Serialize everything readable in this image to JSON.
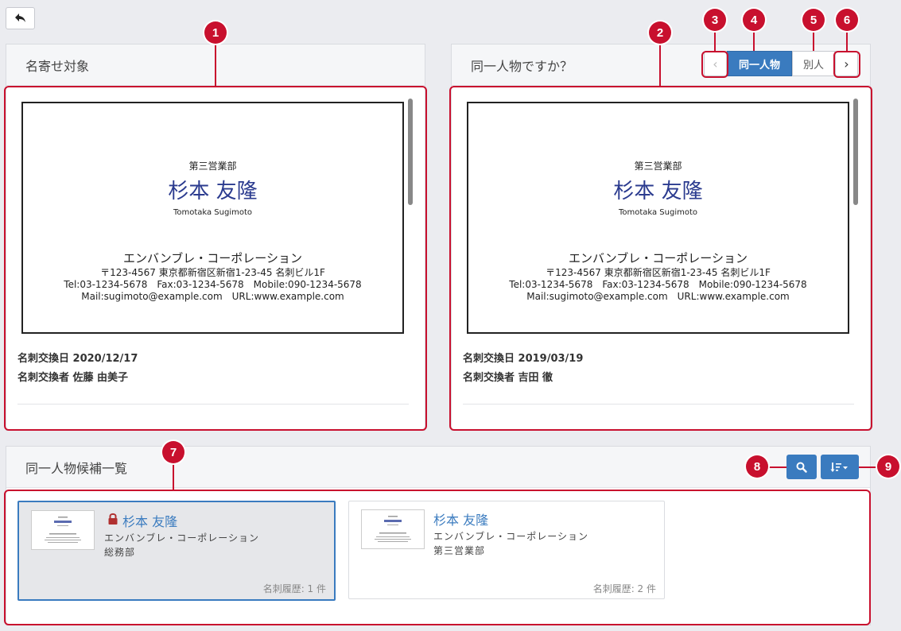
{
  "back_button": {
    "icon": "reply-arrow-icon"
  },
  "left_panel": {
    "title": "名寄せ対象",
    "card": {
      "department": "第三営業部",
      "name": "杉本 友隆",
      "name_romaji": "Tomotaka Sugimoto",
      "company": "エンバンブレ・コーポレーション",
      "address": "〒123-4567 東京都新宿区新宿1-23-45 名刺ビル1F",
      "phones": "Tel:03-1234-5678　Fax:03-1234-5678　Mobile:090-1234-5678",
      "web": "Mail:sugimoto@example.com　URL:www.example.com"
    },
    "exchange_date": "名刺交換日 2020/12/17",
    "exchanger": "名刺交換者 佐藤 由美子"
  },
  "right_panel": {
    "title": "同一人物ですか？",
    "prev_label": "‹",
    "same_person_label": "同一人物",
    "different_person_label": "別人",
    "next_label": "›",
    "card": {
      "department": "第三営業部",
      "name": "杉本 友隆",
      "name_romaji": "Tomotaka Sugimoto",
      "company": "エンバンブレ・コーポレーション",
      "address": "〒123-4567 東京都新宿区新宿1-23-45 名刺ビル1F",
      "phones": "Tel:03-1234-5678　Fax:03-1234-5678　Mobile:090-1234-5678",
      "web": "Mail:sugimoto@example.com　URL:www.example.com"
    },
    "exchange_date": "名刺交換日 2019/03/19",
    "exchanger": "名刺交換者 吉田 徹"
  },
  "candidates_panel": {
    "title": "同一人物候補一覧",
    "search_icon": "search-icon",
    "sort_icon": "sort-icon",
    "items": [
      {
        "name": "杉本 友隆",
        "company": "エンバンブレ・コーポレーション",
        "department": "総務部",
        "history": "名刺履歴: 1 件",
        "locked": true
      },
      {
        "name": "杉本 友隆",
        "company": "エンバンブレ・コーポレーション",
        "department": "第三営業部",
        "history": "名刺履歴: 2 件",
        "locked": false
      }
    ]
  },
  "annotations": [
    "1",
    "2",
    "3",
    "4",
    "5",
    "6",
    "7",
    "8",
    "9"
  ],
  "colors": {
    "accent": "#3a7bbf",
    "annotation": "#c8102e",
    "card_name": "#2b3b8f"
  }
}
